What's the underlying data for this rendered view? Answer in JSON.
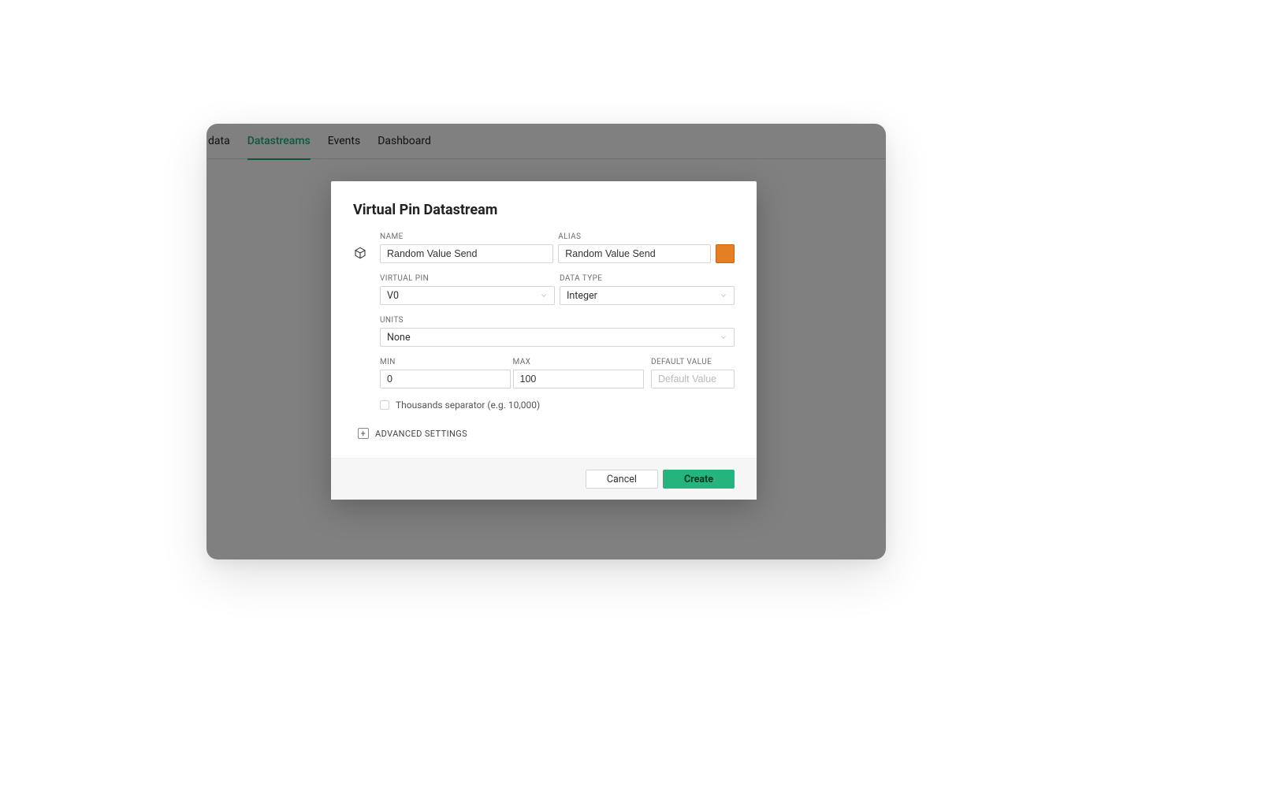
{
  "tabs": {
    "partial": "data",
    "datastreams": "Datastreams",
    "events": "Events",
    "dashboard": "Dashboard"
  },
  "modal": {
    "title": "Virtual Pin Datastream",
    "labels": {
      "name": "NAME",
      "alias": "ALIAS",
      "virtual_pin": "VIRTUAL PIN",
      "data_type": "DATA TYPE",
      "units": "UNITS",
      "min": "MIN",
      "max": "MAX",
      "default_value": "DEFAULT VALUE"
    },
    "values": {
      "name": "Random Value Send",
      "alias": "Random Value Send",
      "virtual_pin": "V0",
      "data_type": "Integer",
      "units": "None",
      "min": "0",
      "max": "100",
      "default_value": ""
    },
    "placeholders": {
      "default_value": "Default Value"
    },
    "color": "#e67e22",
    "checkbox_label": "Thousands separator (e.g. 10,000)",
    "advanced": "ADVANCED SETTINGS",
    "buttons": {
      "cancel": "Cancel",
      "create": "Create"
    }
  }
}
